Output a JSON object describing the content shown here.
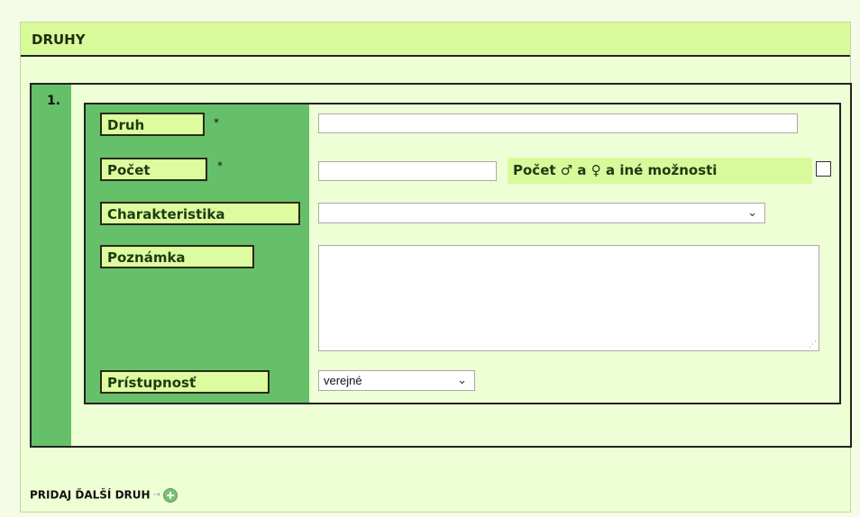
{
  "section": {
    "title": "DRUHY",
    "entry_number": "1.",
    "fields": {
      "species": {
        "label": "Druh",
        "required_mark": "*",
        "value": ""
      },
      "count": {
        "label": "Počet",
        "required_mark": "*",
        "value": "",
        "extra_label": "Počet ♂ a ♀ a iné možnosti",
        "extra_checked": false
      },
      "characteristic": {
        "label": "Charakteristika",
        "selected": ""
      },
      "note": {
        "label": "Poznámka",
        "value": ""
      },
      "accessibility": {
        "label": "Prístupnosť",
        "selected": "verejné"
      }
    },
    "add_more": {
      "label": "PRIDAJ ĎALŠÍ DRUH",
      "arrow": "→",
      "icon": "add-circle-icon"
    }
  },
  "colors": {
    "page_bg": "#f4fbe6",
    "header_bg": "#d9fa9b",
    "label_column": "#66c06a",
    "label_bg": "#ddfb9f",
    "add_icon": "#7dbf75"
  }
}
